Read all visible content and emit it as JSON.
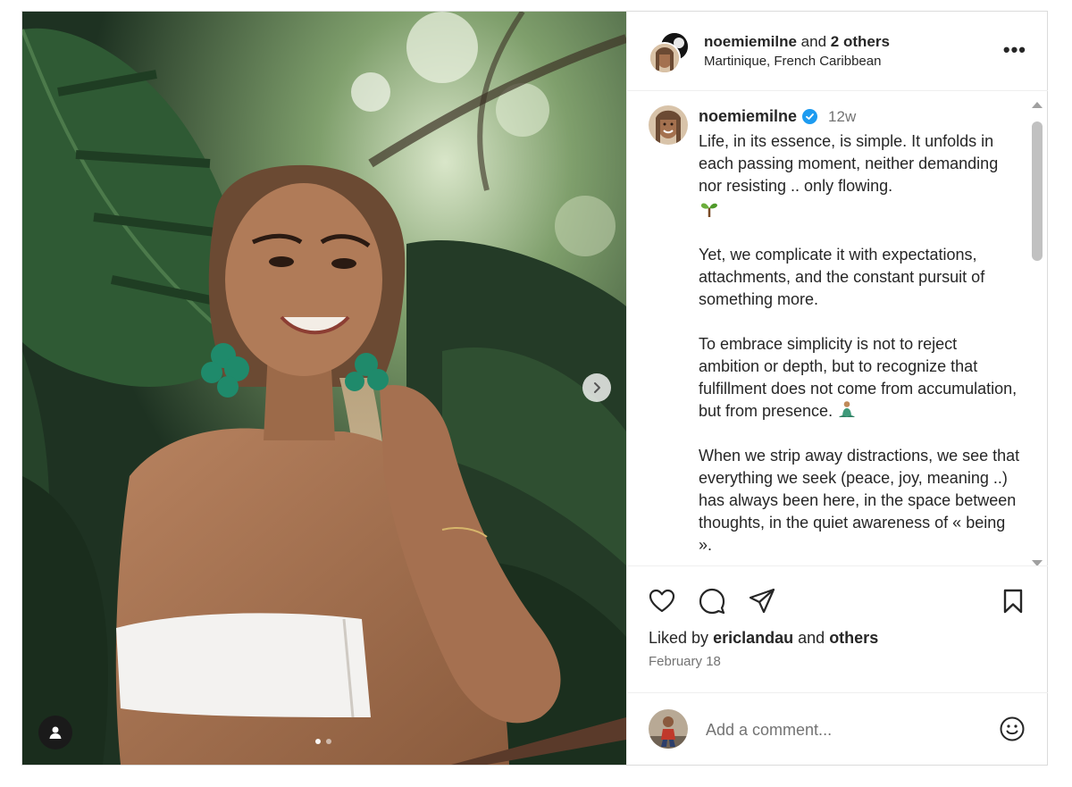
{
  "header": {
    "username": "noemiemilne",
    "joiner": "and",
    "others_count": "2 others",
    "location": "Martinique, French Caribbean",
    "more_label": "•••"
  },
  "caption": {
    "username": "noemiemilne",
    "time": "12w",
    "paragraphs": [
      "Life, in its essence, is simple. It unfolds in each passing moment, neither demanding nor resisting .. only flowing.",
      "Yet, we complicate it with expectations, attachments, and the constant pursuit of something more.",
      "To embrace simplicity is not to reject ambition or depth, but to recognize that fulfillment does not come from accumulation, but from presence.",
      "When we strip away distractions, we see that everything we seek (peace, joy, meaning ..) has always been here, in the space between thoughts, in the quiet awareness of « being »."
    ]
  },
  "likes": {
    "prefix": "Liked by",
    "user": "ericlandau",
    "joiner": "and",
    "suffix": "others"
  },
  "date": "February 18",
  "comment": {
    "placeholder": "Add a comment..."
  },
  "icons": {
    "like": "heart-icon",
    "comment": "comment-icon",
    "share": "share-icon",
    "save": "bookmark-icon",
    "emoji": "smiley-icon",
    "next": "chevron-right-icon",
    "tag": "user-tag-icon",
    "verified": "verified-badge-icon"
  },
  "carousel": {
    "count": 2,
    "active_index": 0
  },
  "colors": {
    "verified": "#1d9bf0",
    "text": "#262626",
    "muted": "#737373",
    "border": "#dbdbdb"
  }
}
